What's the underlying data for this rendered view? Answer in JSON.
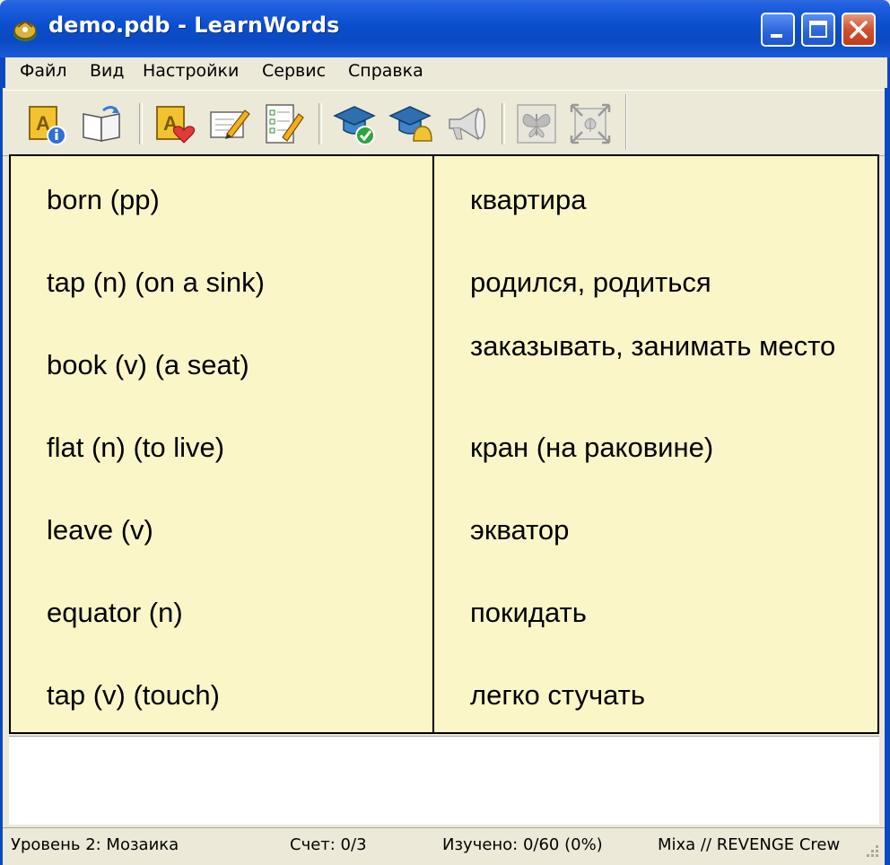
{
  "window": {
    "title": "demo.pdb - LearnWords"
  },
  "menu": {
    "items": [
      "Файл",
      "Вид",
      "Настройки",
      "Сервис",
      "Справка"
    ]
  },
  "toolbar": {
    "icons": [
      "dictionary-info-icon",
      "open-book-icon",
      "favorites-icon",
      "edit-word-icon",
      "checklist-edit-icon",
      "graduate-check-icon",
      "graduate-bell-icon",
      "megaphone-icon",
      "butterfly-icon",
      "fullscreen-icon"
    ]
  },
  "words": {
    "left": [
      "born (pp)",
      "tap (n) (on a sink)",
      "book (v) (a seat)",
      "flat (n) (to live)",
      "leave (v)",
      "equator (n)",
      "tap (v) (touch)"
    ],
    "right": [
      "квартира",
      "родился, родиться",
      "заказывать, занимать место",
      "кран (на раковине)",
      "экватор",
      "покидать",
      "легко стучать"
    ]
  },
  "status": {
    "level": "Уровень 2: Мозаика",
    "score": "Счет: 0/3",
    "learned": "Изучено: 0/60 (0%)",
    "credit": "Mixa // REVENGE Crew"
  },
  "colors": {
    "titlebar": "#0A49C2",
    "mosaic_background": "#FAF6C8",
    "chrome": "#ECE9D8"
  }
}
